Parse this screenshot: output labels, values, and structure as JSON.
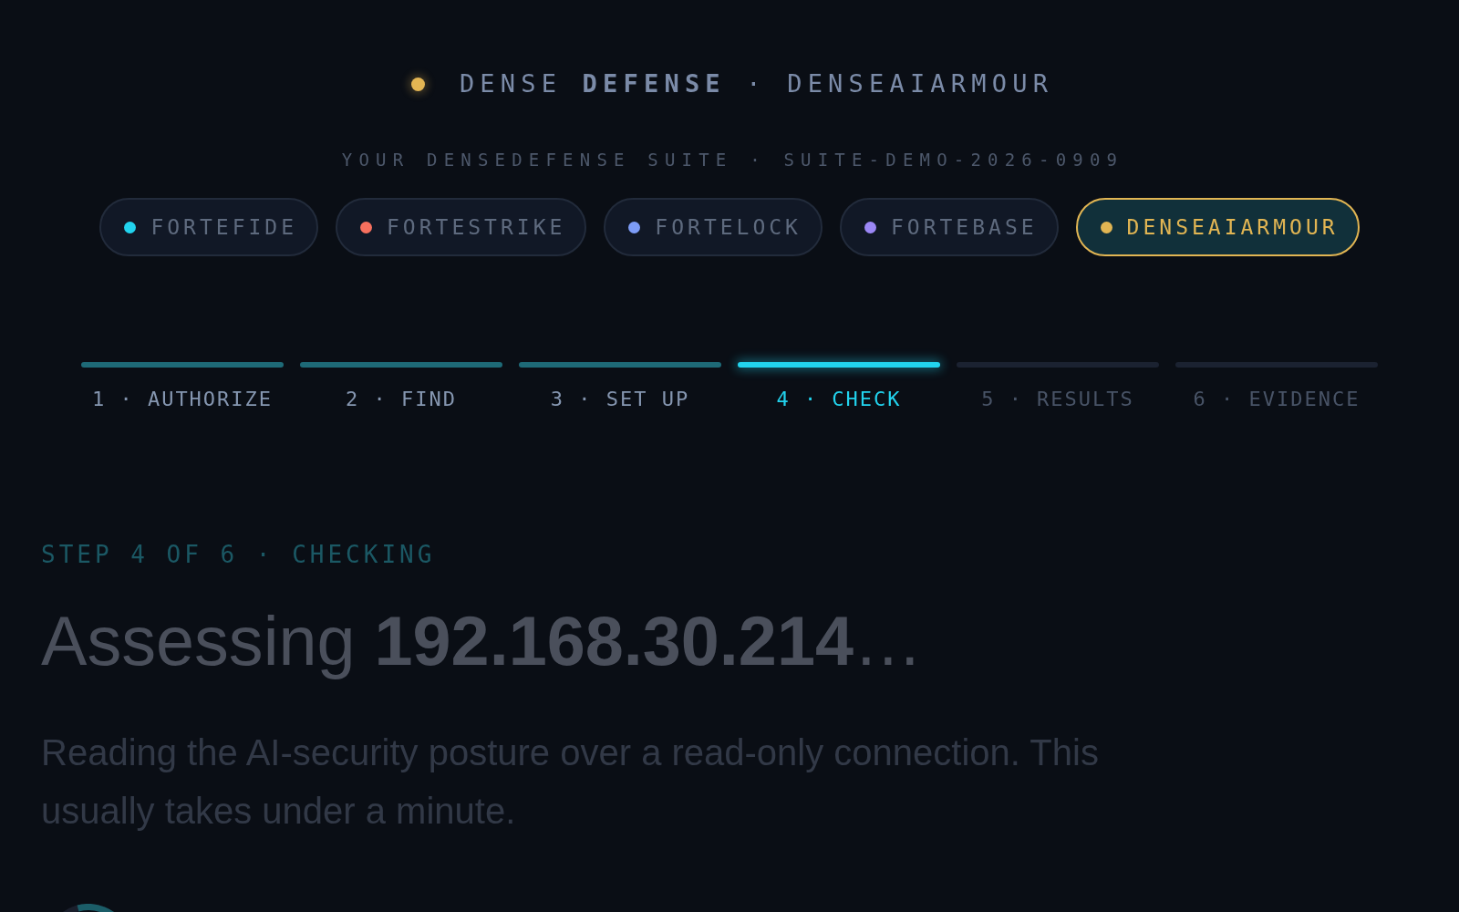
{
  "header": {
    "brand": "DENSE **DEFENSE** · DENSEAIARMOUR"
  },
  "suite": {
    "subtitle": "YOUR DENSEDEFENSE SUITE · SUITE-DEMO-2026-0909",
    "products": [
      {
        "label": "FORTEFIDE",
        "color": "#22d3ee",
        "selected": false
      },
      {
        "label": "FORTESTRIKE",
        "color": "#f7705e",
        "selected": false
      },
      {
        "label": "FORTELOCK",
        "color": "#7d9cf6",
        "selected": false
      },
      {
        "label": "FORTEBASE",
        "color": "#9b87f5",
        "selected": false
      },
      {
        "label": "DENSEAIARMOUR",
        "color": "#e1b553",
        "selected": true
      }
    ]
  },
  "steps": [
    {
      "label": "1 · AUTHORIZE",
      "completed": true,
      "selected": false
    },
    {
      "label": "2 · FIND",
      "completed": true,
      "selected": false
    },
    {
      "label": "3 · SET UP",
      "completed": true,
      "selected": false
    },
    {
      "label": "4 · CHECK",
      "completed": false,
      "selected": true
    },
    {
      "label": "5 · RESULTS",
      "completed": false,
      "selected": false
    },
    {
      "label": "6 · EVIDENCE",
      "completed": false,
      "selected": false
    }
  ],
  "main": {
    "eyebrow": "STEP 4 OF 6 · CHECKING",
    "title": "Assessing **192.168.30.214**…",
    "description": "Reading the AI-security posture over a read-only connection. This usually takes under a minute."
  }
}
